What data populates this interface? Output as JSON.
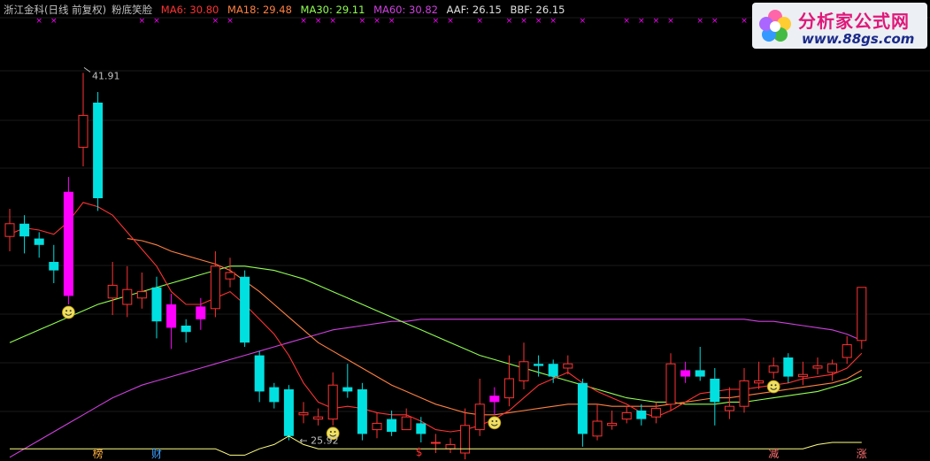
{
  "header": {
    "stock_name": "浙江金科(日线 前复权)",
    "indicator_name": "粉底笑脸",
    "ma6": "MA6: 30.80",
    "ma18": "MA18: 29.48",
    "ma30": "MA30: 29.11",
    "ma60": "MA60: 30.82",
    "aaf": "AAF: 26.15",
    "bbf": "BBF: 26.15"
  },
  "logo": {
    "title": "分析家公式网",
    "url": "www.88gs.com"
  },
  "colors": {
    "up": "#ff3232",
    "down": "#00e0e0",
    "signal": "#ff00ff",
    "ma6": "#ff3232",
    "ma18": "#ff8040",
    "ma30": "#90ff50",
    "ma60": "#d040e0",
    "text": "#c0c0c0",
    "bottom_line": "#ffff80"
  },
  "chart_data": {
    "type": "candlestick",
    "price_range": [
      24.5,
      44.5
    ],
    "annotations": {
      "high": "41.91",
      "low": "25.92"
    },
    "candles": [
      [
        34.2,
        34.8,
        35.5,
        33.5
      ],
      [
        34.8,
        34.2,
        35.2,
        33.4
      ],
      [
        34.1,
        33.8,
        34.4,
        33.2
      ],
      [
        33.0,
        32.6,
        33.8,
        32.0
      ],
      [
        31.4,
        36.3,
        37.0,
        31.0
      ],
      [
        38.4,
        39.9,
        41.9,
        37.5
      ],
      [
        40.5,
        36.0,
        41.0,
        35.4
      ],
      [
        31.3,
        31.9,
        33.0,
        30.5
      ],
      [
        31.0,
        31.7,
        32.8,
        30.4
      ],
      [
        31.3,
        31.6,
        32.5,
        30.8
      ],
      [
        31.8,
        30.2,
        32.3,
        29.4
      ],
      [
        31.0,
        29.9,
        31.5,
        28.9
      ],
      [
        30.0,
        29.7,
        30.3,
        29.2
      ],
      [
        30.3,
        30.9,
        31.3,
        29.8
      ],
      [
        30.8,
        32.8,
        33.5,
        30.4
      ],
      [
        32.2,
        32.5,
        33.2,
        31.8
      ],
      [
        32.3,
        29.2,
        32.6,
        29.0
      ],
      [
        28.6,
        26.9,
        28.8,
        26.4
      ],
      [
        27.1,
        26.4,
        27.3,
        26.1
      ],
      [
        27.0,
        24.8,
        27.2,
        24.6
      ],
      [
        25.8,
        25.9,
        26.4,
        25.4
      ],
      [
        25.6,
        25.7,
        26.1,
        25.3
      ],
      [
        25.6,
        27.2,
        27.8,
        25.3
      ],
      [
        27.1,
        26.9,
        28.2,
        26.6
      ],
      [
        27.0,
        24.9,
        27.3,
        24.6
      ],
      [
        25.1,
        25.4,
        25.9,
        24.7
      ],
      [
        25.6,
        25.0,
        26.0,
        24.8
      ],
      [
        25.1,
        25.7,
        26.1,
        25.2
      ],
      [
        25.4,
        24.9,
        25.7,
        24.5
      ],
      [
        24.5,
        24.5,
        24.9,
        24.0
      ],
      [
        24.2,
        24.4,
        24.7,
        24.0
      ],
      [
        24.0,
        25.3,
        26.1,
        23.7
      ],
      [
        25.1,
        26.3,
        27.5,
        24.8
      ],
      [
        26.4,
        26.7,
        27.1,
        25.8
      ],
      [
        26.6,
        27.5,
        28.6,
        26.2
      ],
      [
        27.4,
        28.3,
        29.2,
        27.0
      ],
      [
        28.2,
        28.1,
        28.6,
        27.6
      ],
      [
        28.2,
        27.6,
        28.4,
        27.3
      ],
      [
        28.0,
        28.2,
        28.6,
        27.7
      ],
      [
        27.3,
        24.9,
        27.5,
        24.3
      ],
      [
        24.8,
        25.5,
        26.3,
        24.6
      ],
      [
        25.3,
        25.4,
        26.0,
        25.1
      ],
      [
        25.6,
        25.9,
        26.2,
        25.4
      ],
      [
        26.0,
        25.6,
        26.3,
        25.3
      ],
      [
        25.7,
        26.1,
        26.4,
        25.4
      ],
      [
        26.3,
        28.2,
        28.7,
        26.0
      ],
      [
        27.6,
        27.9,
        28.3,
        27.3
      ],
      [
        27.9,
        27.6,
        29.0,
        27.4
      ],
      [
        27.5,
        26.4,
        28.0,
        25.3
      ],
      [
        26.0,
        26.2,
        27.1,
        25.6
      ],
      [
        26.2,
        27.4,
        28.0,
        25.9
      ],
      [
        27.3,
        27.4,
        28.3,
        27.0
      ],
      [
        27.8,
        28.1,
        28.5,
        27.5
      ],
      [
        28.5,
        27.6,
        28.7,
        27.3
      ],
      [
        27.6,
        27.7,
        28.3,
        27.2
      ],
      [
        28.0,
        28.1,
        28.5,
        27.7
      ],
      [
        27.8,
        28.2,
        28.4,
        27.4
      ],
      [
        28.5,
        29.1,
        29.5,
        28.2
      ],
      [
        29.3,
        31.8,
        31.8,
        28.9
      ]
    ],
    "signal_candles": [
      4,
      11,
      13,
      33,
      46
    ],
    "smiley_candles": [
      4,
      22,
      33,
      52
    ],
    "ma6": [
      34.3,
      34.6,
      34.5,
      34.3,
      34.9,
      35.8,
      35.6,
      35.2,
      34.4,
      33.6,
      32.8,
      31.6,
      31.0,
      31.0,
      31.3,
      31.6,
      31.0,
      30.3,
      29.6,
      28.6,
      27.3,
      26.4,
      26.1,
      26.2,
      26.1,
      25.9,
      25.8,
      25.8,
      25.5,
      25.1,
      25.0,
      25.1,
      25.3,
      25.6,
      26.0,
      26.6,
      27.2,
      27.5,
      27.8,
      27.3,
      26.9,
      26.6,
      26.3,
      25.9,
      25.7,
      26.0,
      26.4,
      26.8,
      26.9,
      27.0,
      27.0,
      27.1,
      27.2,
      27.3,
      27.5,
      27.6,
      27.7,
      28.0,
      28.7
    ],
    "ma18": [
      null,
      null,
      null,
      null,
      null,
      null,
      null,
      null,
      34.1,
      34.0,
      33.8,
      33.5,
      33.3,
      33.1,
      32.9,
      32.6,
      32.1,
      31.6,
      31.0,
      30.4,
      29.8,
      29.2,
      28.8,
      28.4,
      28.0,
      27.6,
      27.2,
      26.9,
      26.6,
      26.3,
      26.1,
      25.9,
      25.8,
      25.8,
      25.9,
      26.0,
      26.1,
      26.2,
      26.3,
      26.3,
      26.3,
      26.2,
      26.2,
      26.2,
      26.2,
      26.3,
      26.4,
      26.5,
      26.6,
      26.6,
      26.7,
      26.8,
      26.9,
      27.0,
      27.1,
      27.2,
      27.3,
      27.5,
      27.9
    ],
    "ma30": [
      29.2,
      29.5,
      29.8,
      30.1,
      30.4,
      30.7,
      31.0,
      31.2,
      31.4,
      31.6,
      31.8,
      32.0,
      32.2,
      32.4,
      32.6,
      32.8,
      32.8,
      32.7,
      32.6,
      32.4,
      32.2,
      31.9,
      31.6,
      31.3,
      31.0,
      30.7,
      30.4,
      30.1,
      29.8,
      29.5,
      29.2,
      28.9,
      28.6,
      28.4,
      28.2,
      28.0,
      27.8,
      27.6,
      27.4,
      27.2,
      27.0,
      26.8,
      26.6,
      26.5,
      26.4,
      26.4,
      26.3,
      26.3,
      26.3,
      26.4,
      26.4,
      26.5,
      26.6,
      26.7,
      26.8,
      26.9,
      27.1,
      27.3,
      27.6
    ],
    "ma60": [
      23.8,
      24.2,
      24.6,
      25.0,
      25.4,
      25.8,
      26.2,
      26.6,
      26.9,
      27.2,
      27.4,
      27.6,
      27.8,
      28.0,
      28.2,
      28.4,
      28.6,
      28.8,
      29.0,
      29.2,
      29.4,
      29.6,
      29.8,
      29.9,
      30.0,
      30.1,
      30.2,
      30.2,
      30.3,
      30.3,
      30.3,
      30.3,
      30.3,
      30.3,
      30.3,
      30.3,
      30.3,
      30.3,
      30.3,
      30.3,
      30.3,
      30.3,
      30.3,
      30.3,
      30.3,
      30.3,
      30.3,
      30.3,
      30.3,
      30.3,
      30.3,
      30.2,
      30.2,
      30.1,
      30.0,
      29.9,
      29.8,
      29.6,
      29.3
    ],
    "bottom_line": [
      24.2,
      24.2,
      24.2,
      24.2,
      24.2,
      24.2,
      24.2,
      24.2,
      24.2,
      24.2,
      24.2,
      24.2,
      24.2,
      24.2,
      24.2,
      23.9,
      23.9,
      24.2,
      24.4,
      24.8,
      24.4,
      24.2,
      24.2,
      24.2,
      24.2,
      24.2,
      24.2,
      24.2,
      24.2,
      24.2,
      24.2,
      24.2,
      24.2,
      24.2,
      24.2,
      24.2,
      24.2,
      24.2,
      24.2,
      24.2,
      24.2,
      24.2,
      24.2,
      24.2,
      24.2,
      24.2,
      24.2,
      24.2,
      24.2,
      24.2,
      24.2,
      24.2,
      24.2,
      24.2,
      24.2,
      24.4,
      24.5,
      24.5,
      24.5
    ],
    "top_marker_candles": [
      2,
      3,
      9,
      10,
      14,
      15,
      20,
      21,
      22,
      24,
      25,
      26,
      29,
      30,
      32,
      34,
      35,
      36,
      37,
      39,
      42,
      43,
      44,
      45,
      47,
      48,
      50,
      52,
      55,
      56,
      58
    ],
    "bottom_markers": [
      {
        "candle": 6,
        "label": "榜"
      },
      {
        "candle": 10,
        "label": "财"
      },
      {
        "candle": 28,
        "label": "$"
      },
      {
        "candle": 52,
        "label": "减"
      },
      {
        "candle": 58,
        "label": "涨"
      }
    ]
  }
}
